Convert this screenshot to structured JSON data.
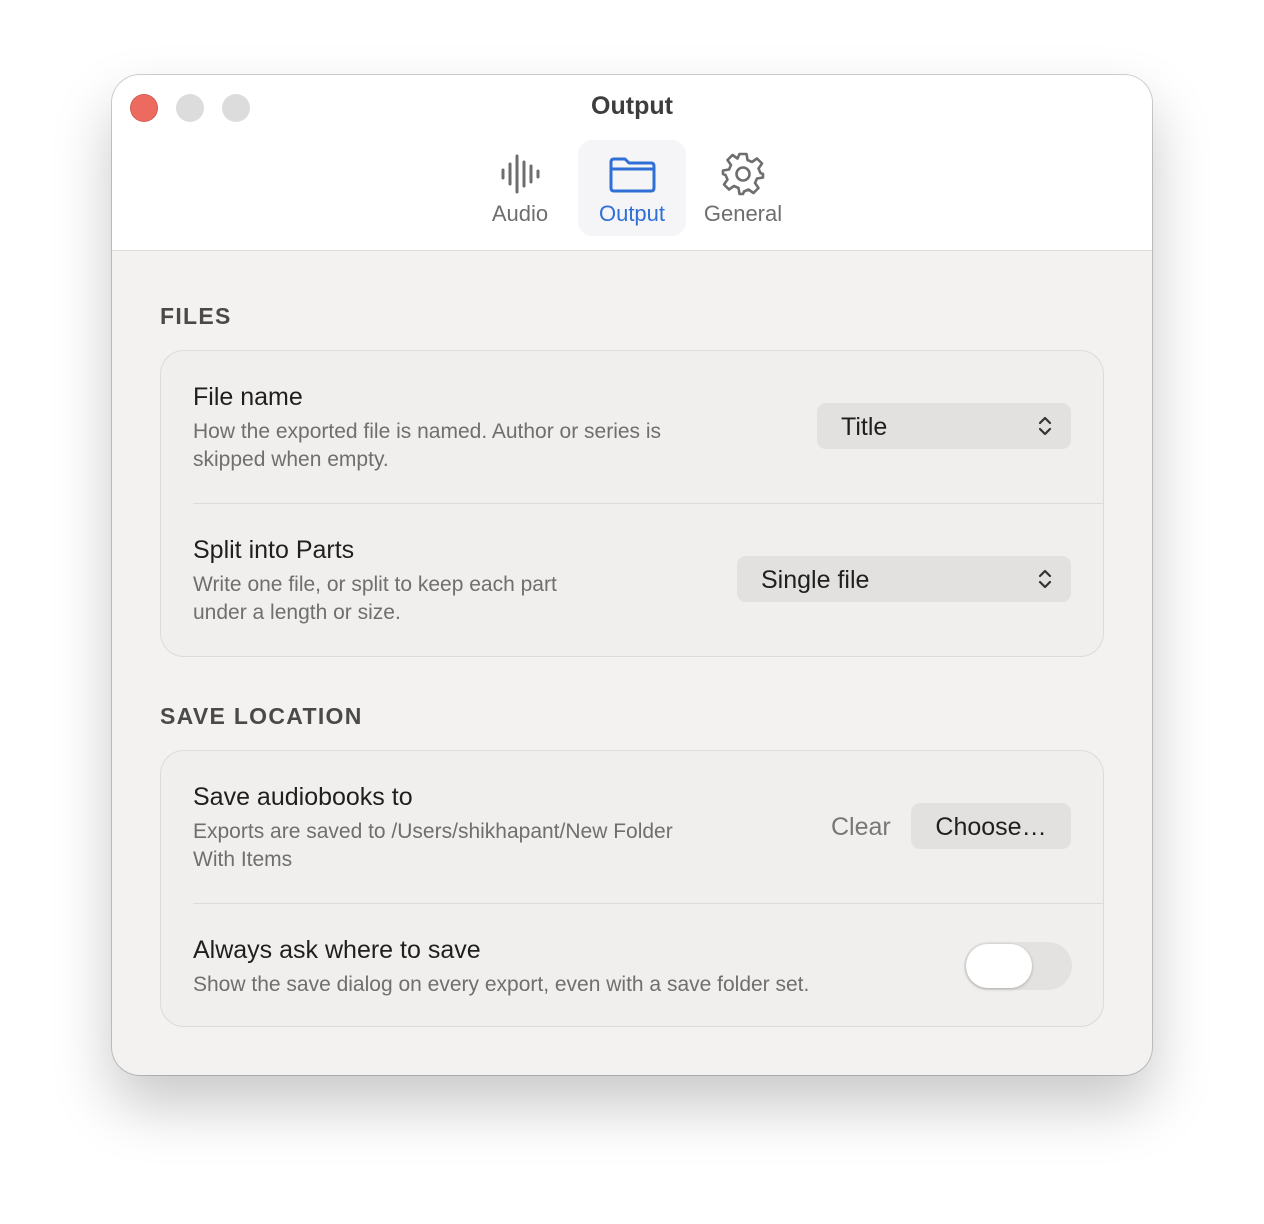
{
  "window": {
    "title": "Output"
  },
  "tabs": [
    {
      "label": "Audio",
      "icon": "waveform-icon",
      "active": false
    },
    {
      "label": "Output",
      "icon": "folder-icon",
      "active": true
    },
    {
      "label": "General",
      "icon": "gear-icon",
      "active": false
    }
  ],
  "files": {
    "heading": "FILES",
    "file_name": {
      "title": "File name",
      "description_line1": "How the exported file is named. Author or series is",
      "description_line2": "skipped when empty.",
      "value": "Title"
    },
    "split": {
      "title": "Split into Parts",
      "description_line1": "Write one file, or split to keep each part",
      "description_line2": "under a length or size.",
      "value": "Single file"
    }
  },
  "save_location": {
    "heading": "SAVE LOCATION",
    "save_to": {
      "title": "Save audiobooks to",
      "description_line1": "Exports are saved to /Users/shikhapant/New Folder",
      "description_line2": "With Items",
      "clear_label": "Clear",
      "choose_label": "Choose…"
    },
    "always_ask": {
      "title": "Always ask where to save",
      "description": "Show the save dialog on every export, even with a save folder set.",
      "enabled": false
    }
  },
  "colors": {
    "accent": "#2f6fd6",
    "close": "#ed6a5e"
  }
}
